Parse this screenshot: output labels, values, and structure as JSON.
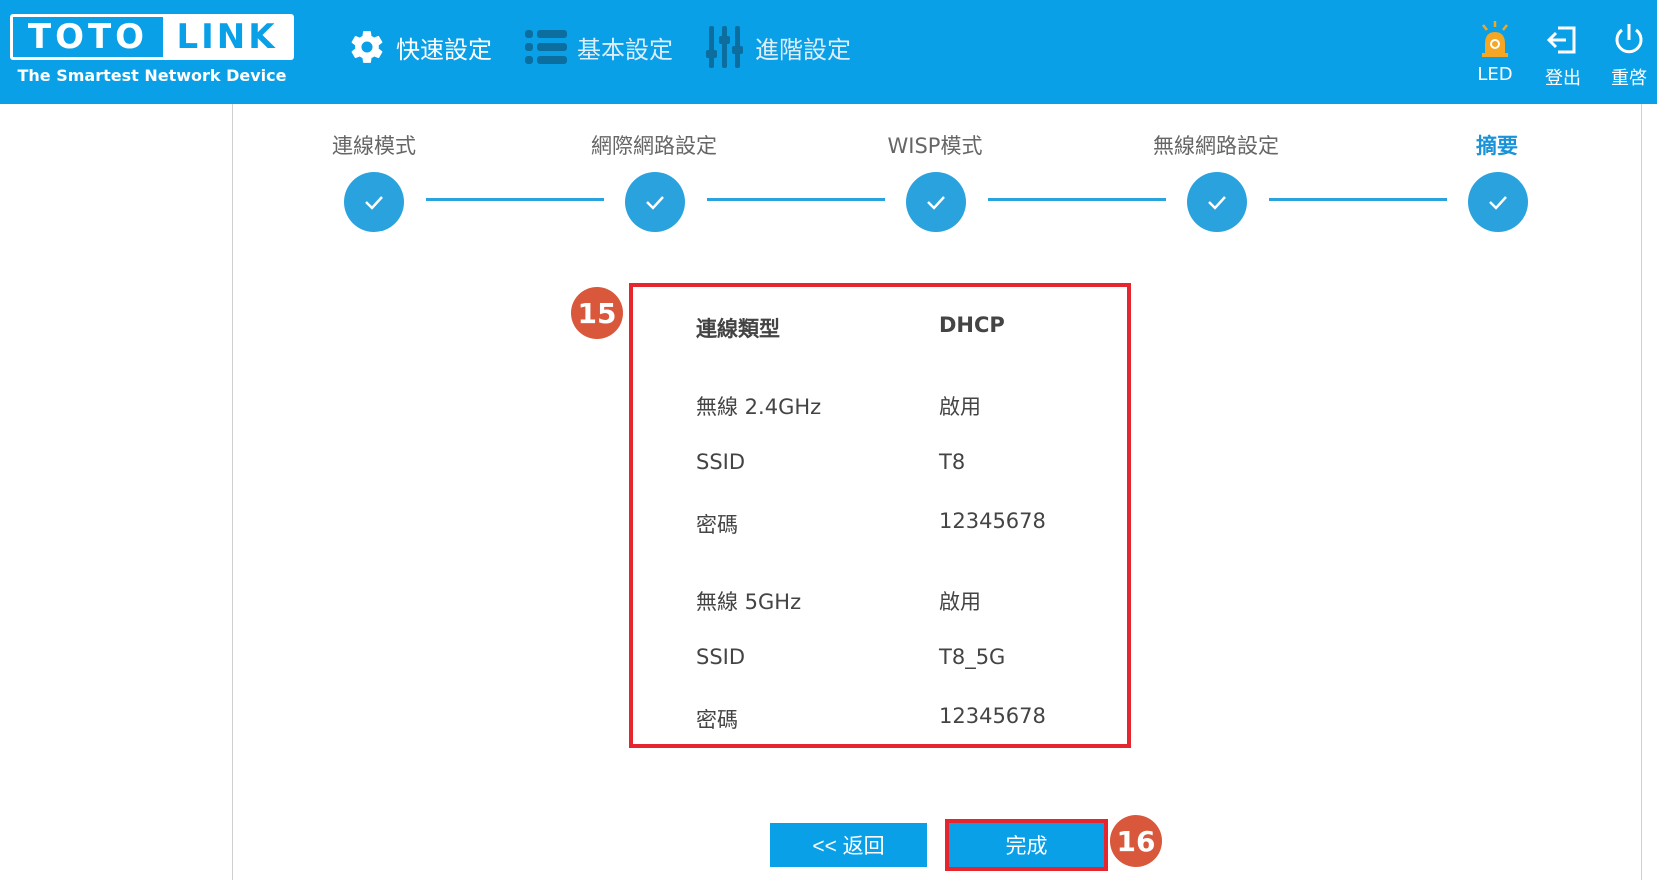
{
  "brand": {
    "name_left": "TOTO",
    "name_right": "LINK",
    "tagline": "The Smartest Network Device"
  },
  "nav": [
    {
      "label": "快速設定",
      "icon": "gear-icon",
      "active": true
    },
    {
      "label": "基本設定",
      "icon": "list-icon",
      "active": false
    },
    {
      "label": "進階設定",
      "icon": "sliders-icon",
      "active": false
    }
  ],
  "header_buttons": {
    "led": "LED",
    "logout": "登出",
    "reboot": "重啓"
  },
  "steps": [
    {
      "label": "連線模式",
      "done": true
    },
    {
      "label": "網際網路設定",
      "done": true
    },
    {
      "label": "WISP模式",
      "done": true
    },
    {
      "label": "無線網路設定",
      "done": true
    },
    {
      "label": "摘要",
      "done": true,
      "current": true
    }
  ],
  "summary": {
    "connection_type": {
      "label": "連線類型",
      "value": "DHCP"
    },
    "wifi24": {
      "label": "無線 2.4GHz",
      "value": "啟用"
    },
    "ssid24": {
      "label": "SSID",
      "value": "T8"
    },
    "pass24": {
      "label": "密碼",
      "value": "12345678"
    },
    "wifi5": {
      "label": "無線 5GHz",
      "value": "啟用"
    },
    "ssid5": {
      "label": "SSID",
      "value": "T8_5G"
    },
    "pass5": {
      "label": "密碼",
      "value": "12345678"
    }
  },
  "annotations": {
    "box": "15",
    "finish": "16"
  },
  "buttons": {
    "back": "<< 返回",
    "finish": "完成"
  },
  "colors": {
    "header": "#0aa0e8",
    "step": "#2aa2de",
    "highlight": "#e5262f",
    "badge": "#d9573a"
  }
}
